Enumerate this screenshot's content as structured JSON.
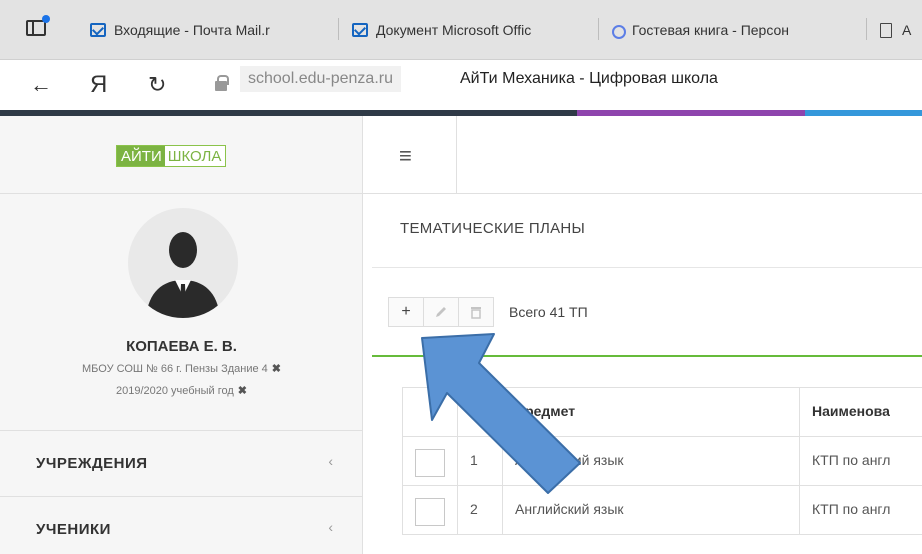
{
  "browser": {
    "tabs": [
      {
        "title": "Входящие - Почта Mail.r"
      },
      {
        "title": "Документ Microsoft Offic"
      },
      {
        "title": "Гостевая книга - Персон"
      },
      {
        "title": "А"
      }
    ],
    "address": {
      "brand_letter": "Я",
      "domain": "school.edu-penza.ru",
      "page_title": "АйТи Механика - Цифровая школа"
    }
  },
  "logo": {
    "part1": "АЙТИ",
    "part2": "ШКОЛА"
  },
  "user": {
    "name": "КОПАЕВА Е. В.",
    "org": "МБОУ СОШ № 66 г. Пензы Здание 4",
    "year": "2019/2020 учебный год",
    "remove_symbol": "✖"
  },
  "sidebar": {
    "items": [
      {
        "label": "УЧРЕЖДЕНИЯ"
      },
      {
        "label": "УЧЕНИКИ"
      }
    ]
  },
  "main": {
    "title": "ТЕМАТИЧЕСКИЕ ПЛАНЫ",
    "toolbar": {
      "total": "Всего 41 ТП"
    },
    "table": {
      "columns": [
        "",
        "",
        "Предмет",
        "Наименова"
      ],
      "rows": [
        {
          "n": "1",
          "subject": "Английский язык",
          "name": "КТП по англ"
        },
        {
          "n": "2",
          "subject": "Английский язык",
          "name": "КТП по англ"
        }
      ]
    }
  },
  "colors": {
    "stripe": [
      "#2f3a47",
      "#8e44ad",
      "#3498db"
    ],
    "accent_green": "#66bb3a",
    "arrow_fill": "#5b93d4",
    "arrow_stroke": "#3b6ea8"
  }
}
